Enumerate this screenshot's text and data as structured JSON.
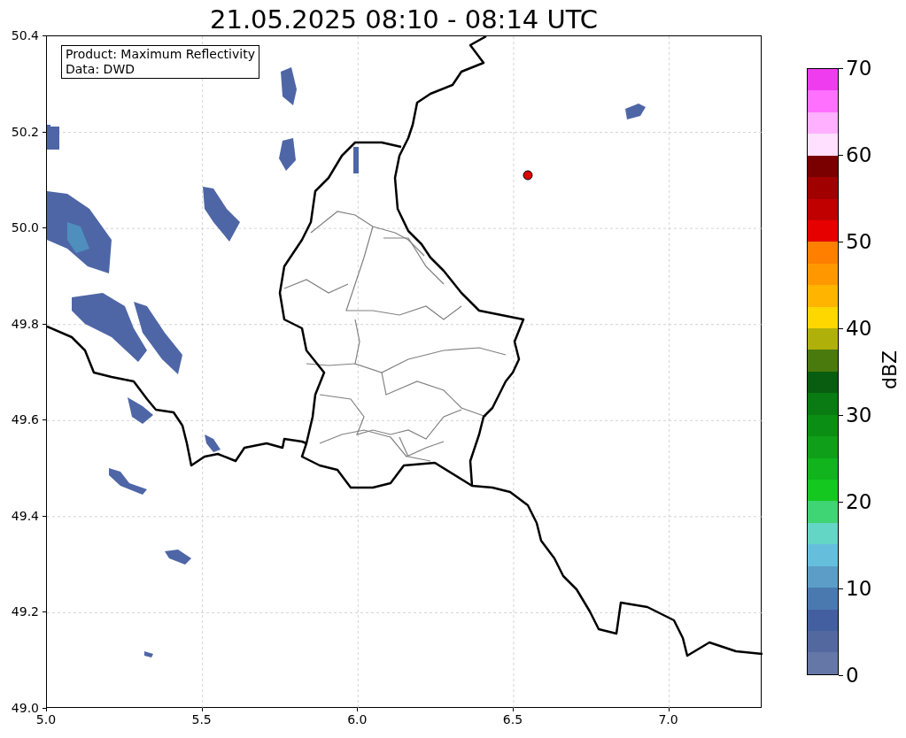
{
  "title": "21.05.2025 08:10 - 08:14 UTC",
  "info_box": {
    "lines": [
      "Product: Maximum Reflectivity",
      "Data: DWD"
    ]
  },
  "map": {
    "x_ticks": [
      "5.0",
      "5.5",
      "6.0",
      "6.5",
      "7.0"
    ],
    "y_ticks": [
      "50.4",
      "50.2",
      "50.0",
      "49.8",
      "49.6",
      "49.4",
      "49.2",
      "49.0"
    ]
  },
  "colorbar": {
    "label": "dBZ",
    "ticks": [
      "70",
      "60",
      "50",
      "40",
      "30",
      "20",
      "10",
      "0"
    ],
    "bins": [
      {
        "color": "#ef3cef"
      },
      {
        "color": "#ff70ff"
      },
      {
        "color": "#ffb0ff"
      },
      {
        "color": "#ffe0ff"
      },
      {
        "color": "#7a0000"
      },
      {
        "color": "#a00000"
      },
      {
        "color": "#c00000"
      },
      {
        "color": "#e60000"
      },
      {
        "color": "#ff7f00"
      },
      {
        "color": "#ff9800"
      },
      {
        "color": "#ffb400"
      },
      {
        "color": "#ffd700"
      },
      {
        "color": "#b0b00a"
      },
      {
        "color": "#4a7a0d"
      },
      {
        "color": "#095d10"
      },
      {
        "color": "#0a7a12"
      },
      {
        "color": "#0b8e14"
      },
      {
        "color": "#0f9f18"
      },
      {
        "color": "#11b41c"
      },
      {
        "color": "#14c81f"
      },
      {
        "color": "#3fd474"
      },
      {
        "color": "#64d6c6"
      },
      {
        "color": "#66bedd"
      },
      {
        "color": "#5b9dc6"
      },
      {
        "color": "#4a79b0"
      },
      {
        "color": "#435f9f"
      },
      {
        "color": "#5468a0"
      },
      {
        "color": "#6477a6"
      }
    ]
  }
}
